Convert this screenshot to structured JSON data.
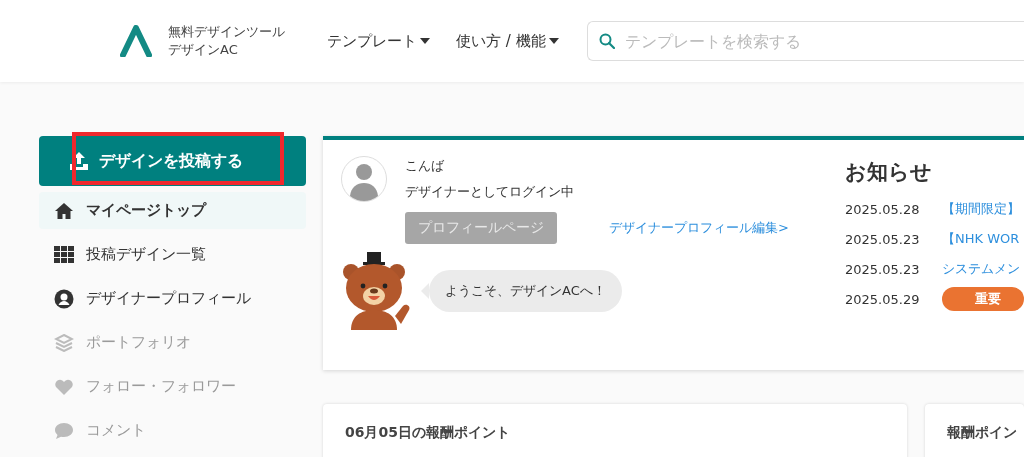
{
  "header": {
    "logo": {
      "tagline": "無料デザインツール",
      "name": "デザインAC"
    },
    "nav": [
      {
        "label": "テンプレート"
      },
      {
        "label": "使い方 / 機能"
      }
    ],
    "search": {
      "placeholder": "テンプレートを検索する"
    }
  },
  "sidebar": {
    "upload_button": {
      "label": "デザインを投稿する",
      "highlighted": true
    },
    "items": [
      {
        "kind": "home",
        "label": "マイページトップ",
        "selected": true,
        "disabled": false
      },
      {
        "kind": "grid",
        "label": "投稿デザイン一覧",
        "selected": false,
        "disabled": false
      },
      {
        "kind": "user",
        "label": "デザイナープロフィール",
        "selected": false,
        "disabled": false
      },
      {
        "kind": "layers",
        "label": "ポートフォリオ",
        "selected": false,
        "disabled": true
      },
      {
        "kind": "heart",
        "label": "フォロー・フォロワー",
        "selected": false,
        "disabled": true
      },
      {
        "kind": "comment",
        "label": "コメント",
        "selected": false,
        "disabled": true
      }
    ]
  },
  "profile": {
    "greeting": "こんば",
    "status": "デザイナーとしてログイン中",
    "profile_button": {
      "label": "プロフィールページ",
      "disabled": true
    },
    "edit_link": "デザイナープロフィール編集>",
    "welcome": "ようこそ、デザインACへ！"
  },
  "news": {
    "title": "お知らせ",
    "items": [
      {
        "date": "2025.05.28",
        "kind": "link",
        "text": "【期間限定】"
      },
      {
        "date": "2025.05.23",
        "kind": "link",
        "text": "【NHK WOR"
      },
      {
        "date": "2025.05.23",
        "kind": "link",
        "text": "システムメン"
      },
      {
        "date": "2025.05.29",
        "kind": "badge",
        "text": "重要"
      }
    ]
  },
  "cards": [
    {
      "title": "06月05日の報酬ポイント"
    },
    {
      "title": "報酬ポイン"
    }
  ]
}
